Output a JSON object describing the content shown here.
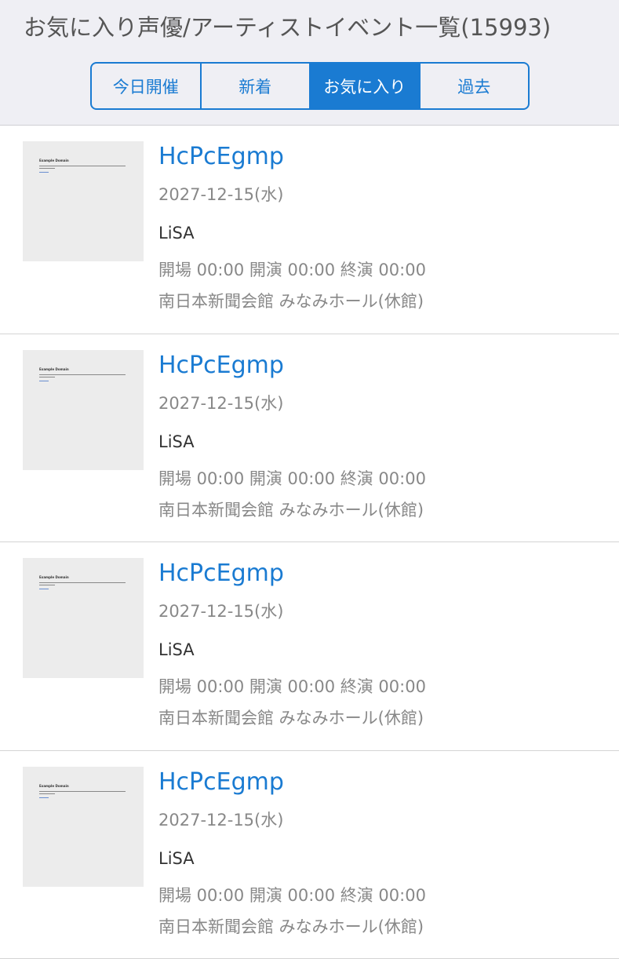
{
  "header": {
    "title": "お気に入り声優/アーティストイベント一覧(15993)"
  },
  "tabs": [
    {
      "label": "今日開催",
      "active": false
    },
    {
      "label": "新着",
      "active": false
    },
    {
      "label": "お気に入り",
      "active": true
    },
    {
      "label": "過去",
      "active": false
    }
  ],
  "events": [
    {
      "title": "HcPcEgmp",
      "date": "2027-12-15(水)",
      "artist": "LiSA",
      "times": "開場 00:00 開演 00:00 終演 00:00",
      "venue": "南日本新聞会館 みなみホール(休館)",
      "thumbnail_text": "Example Domain"
    },
    {
      "title": "HcPcEgmp",
      "date": "2027-12-15(水)",
      "artist": "LiSA",
      "times": "開場 00:00 開演 00:00 終演 00:00",
      "venue": "南日本新聞会館 みなみホール(休館)",
      "thumbnail_text": "Example Domain"
    },
    {
      "title": "HcPcEgmp",
      "date": "2027-12-15(水)",
      "artist": "LiSA",
      "times": "開場 00:00 開演 00:00 終演 00:00",
      "venue": "南日本新聞会館 みなみホール(休館)",
      "thumbnail_text": "Example Domain"
    },
    {
      "title": "HcPcEgmp",
      "date": "2027-12-15(水)",
      "artist": "LiSA",
      "times": "開場 00:00 開演 00:00 終演 00:00",
      "venue": "南日本新聞会館 みなみホール(休館)",
      "thumbnail_text": "Example Domain"
    }
  ],
  "colors": {
    "accent": "#1a7bd2",
    "header_bg": "#efeff4",
    "muted_text": "#888888"
  }
}
